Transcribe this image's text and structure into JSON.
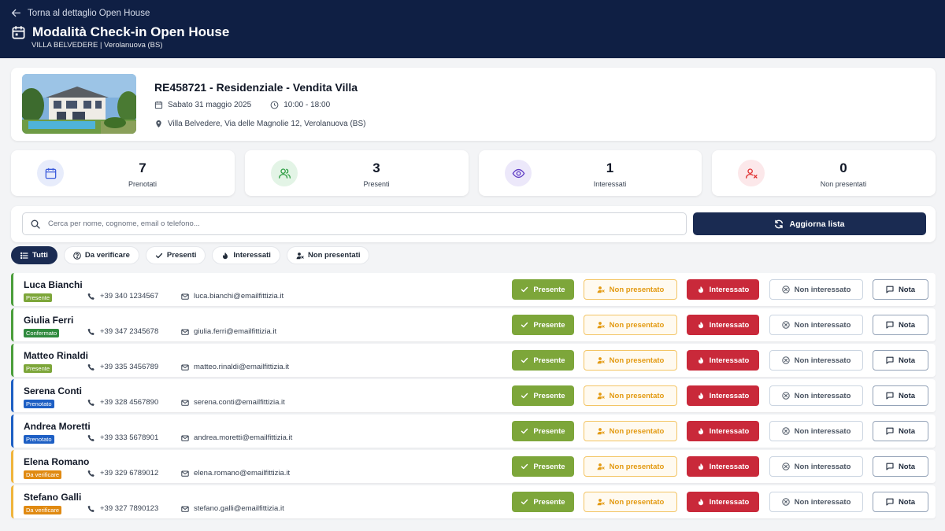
{
  "header": {
    "back_label": "Torna al dettaglio Open House",
    "title": "Modalità Check-in Open House",
    "subtitle": "VILLA BELVEDERE | Verolanuova (BS)",
    "bg_color": "#0f1f44"
  },
  "property": {
    "code_title": "RE458721 - Residenziale - Vendita Villa",
    "date": "Sabato 31 maggio 2025",
    "time": "10:00 - 18:00",
    "address": "Villa Belvedere, Via delle Magnolie 12, Verolanuova (BS)",
    "icons": [
      "calendar-icon",
      "clock-icon",
      "map-pin-icon"
    ]
  },
  "stats": [
    {
      "value": "7",
      "label": "Prenotati",
      "icon": "calendar-icon",
      "color": "#3b5bdb"
    },
    {
      "value": "3",
      "label": "Presenti",
      "icon": "users-icon",
      "color": "#2f9e44"
    },
    {
      "value": "1",
      "label": "Interessati",
      "icon": "eye-icon",
      "color": "#5f3dc4"
    },
    {
      "value": "0",
      "label": "Non presentati",
      "icon": "user-x-icon",
      "color": "#e03131"
    }
  ],
  "search": {
    "placeholder": "Cerca per nome, cognome, email o telefono...",
    "value": "",
    "refresh_label": "Aggiorna lista"
  },
  "tabs": [
    {
      "label": "Tutti",
      "icon": "list-icon",
      "active": true
    },
    {
      "label": "Da verificare",
      "icon": "question-icon",
      "active": false
    },
    {
      "label": "Presenti",
      "icon": "check-icon",
      "active": false
    },
    {
      "label": "Interessati",
      "icon": "flame-icon",
      "active": false
    },
    {
      "label": "Non presentati",
      "icon": "user-x-icon",
      "active": false
    }
  ],
  "actions": {
    "presente": "Presente",
    "non_presentato": "Non presentato",
    "interessato": "Interessato",
    "non_interessato": "Non interessato",
    "nota": "Nota"
  },
  "status_colors": {
    "Presente": "#7da63a",
    "Confermato": "#2f8a3e",
    "Prenotato": "#1d5fc4",
    "Da verificare": "#e08a12"
  },
  "row_border_colors": {
    "Presente": "#4a9d3a",
    "Confermato": "#4a9d3a",
    "Prenotato": "#1d5fc4",
    "Da verificare": "#f0b43c"
  },
  "attendees": [
    {
      "name": "Luca Bianchi",
      "status": "Presente",
      "phone": "+39 340 1234567",
      "email": "luca.bianchi@emailfittizia.it"
    },
    {
      "name": "Giulia Ferri",
      "status": "Confermato",
      "phone": "+39 347 2345678",
      "email": "giulia.ferri@emailfittizia.it"
    },
    {
      "name": "Matteo Rinaldi",
      "status": "Presente",
      "phone": "+39 335 3456789",
      "email": "matteo.rinaldi@emailfittizia.it"
    },
    {
      "name": "Serena Conti",
      "status": "Prenotato",
      "phone": "+39 328 4567890",
      "email": "serena.conti@emailfittizia.it"
    },
    {
      "name": "Andrea Moretti",
      "status": "Prenotato",
      "phone": "+39 333 5678901",
      "email": "andrea.moretti@emailfittizia.it"
    },
    {
      "name": "Elena Romano",
      "status": "Da verificare",
      "phone": "+39 329 6789012",
      "email": "elena.romano@emailfittizia.it"
    },
    {
      "name": "Stefano Galli",
      "status": "Da verificare",
      "phone": "+39 327 7890123",
      "email": "stefano.galli@emailfittizia.it"
    }
  ]
}
